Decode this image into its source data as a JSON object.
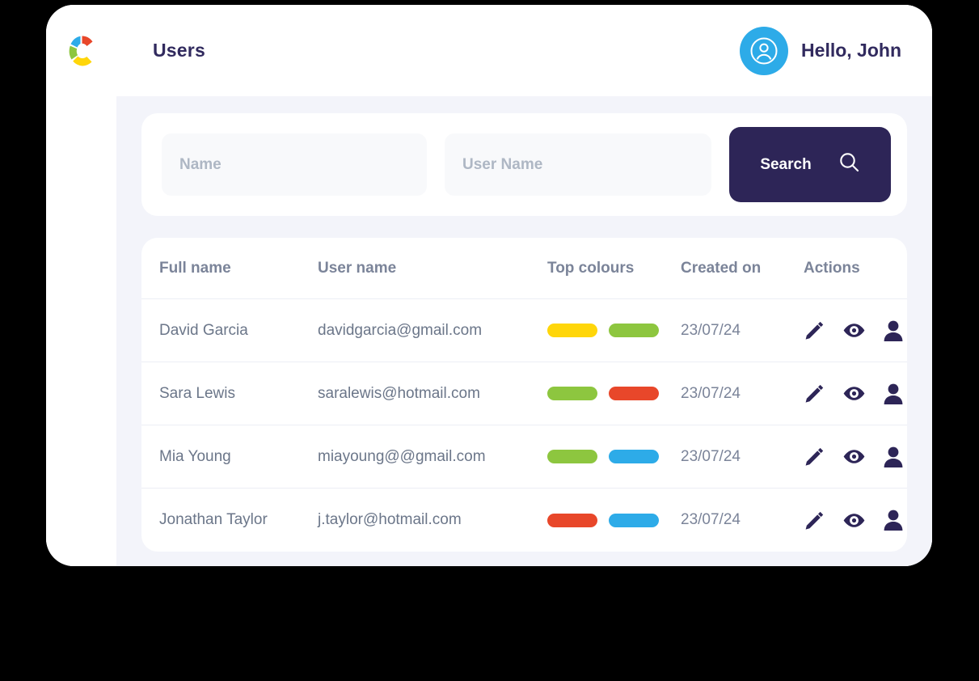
{
  "window": {
    "brand_logo_icon": "cosmos-c-logo-icon",
    "brand_colors": {
      "red": "#E8472A",
      "blue": "#2DABE8",
      "green": "#8DC63F",
      "yellow": "#FFD60A"
    }
  },
  "header": {
    "title": "Users",
    "avatar_icon": "user-avatar-icon",
    "greeting": "Hello, John",
    "accent_navy": "#312A5E",
    "avatar_bg": "#2DABE8"
  },
  "search": {
    "name_placeholder": "Name",
    "name_value": "",
    "username_placeholder": "User Name",
    "username_value": "",
    "search_label": "Search",
    "search_icon": "magnifier-icon",
    "button_color": "#2D2557"
  },
  "table": {
    "columns": [
      "Full name",
      "User name",
      "Top colours",
      "Created on",
      "Actions"
    ],
    "action_icons": [
      "pencil-edit-icon",
      "eye-view-icon",
      "person-profile-icon"
    ],
    "rows": [
      {
        "full_name": "David Garcia",
        "user_name": "davidgarcia@gmail.com",
        "top_colours": [
          "#FFD60A",
          "#8DC63F"
        ],
        "created_on": "23/07/24"
      },
      {
        "full_name": "Sara Lewis",
        "user_name": "saralewis@hotmail.com",
        "top_colours": [
          "#8DC63F",
          "#E8472A"
        ],
        "created_on": "23/07/24"
      },
      {
        "full_name": "Mia Young",
        "user_name": "miayoung@@gmail.com",
        "top_colours": [
          "#8DC63F",
          "#2DABE8"
        ],
        "created_on": "23/07/24"
      },
      {
        "full_name": "Jonathan Taylor",
        "user_name": "j.taylor@hotmail.com",
        "top_colours": [
          "#E8472A",
          "#2DABE8"
        ],
        "created_on": "23/07/24"
      }
    ]
  }
}
